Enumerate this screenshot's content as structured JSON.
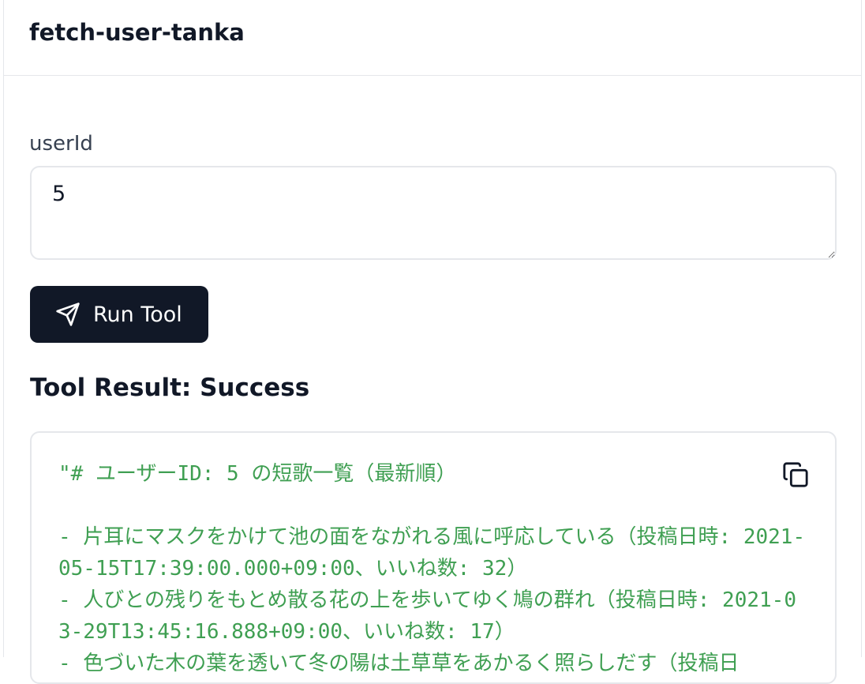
{
  "header": {
    "title": "fetch-user-tanka"
  },
  "form": {
    "field_label": "userId",
    "field_value": "5",
    "run_label": "Run Tool"
  },
  "result": {
    "heading": "Tool Result: Success",
    "text": "\"# ユーザーID: 5 の短歌一覧（最新順）\n\n- 片耳にマスクをかけて池の面をながれる風に呼応している（投稿日時: 2021-05-15T17:39:00.000+09:00、いいね数: 32）\n- 人びとの残りをもとめ散る花の上を歩いてゆく鳩の群れ（投稿日時: 2021-03-29T13:45:16.888+09:00、いいね数: 17）\n- 色づいた木の葉を透いて冬の陽は土草草をあかるく照らしだす（投稿日"
  },
  "icons": {
    "run": "send-icon",
    "copy": "copy-icon"
  },
  "colors": {
    "button_bg": "#111827",
    "result_text": "#3f9f52",
    "border": "#e5e7eb"
  }
}
